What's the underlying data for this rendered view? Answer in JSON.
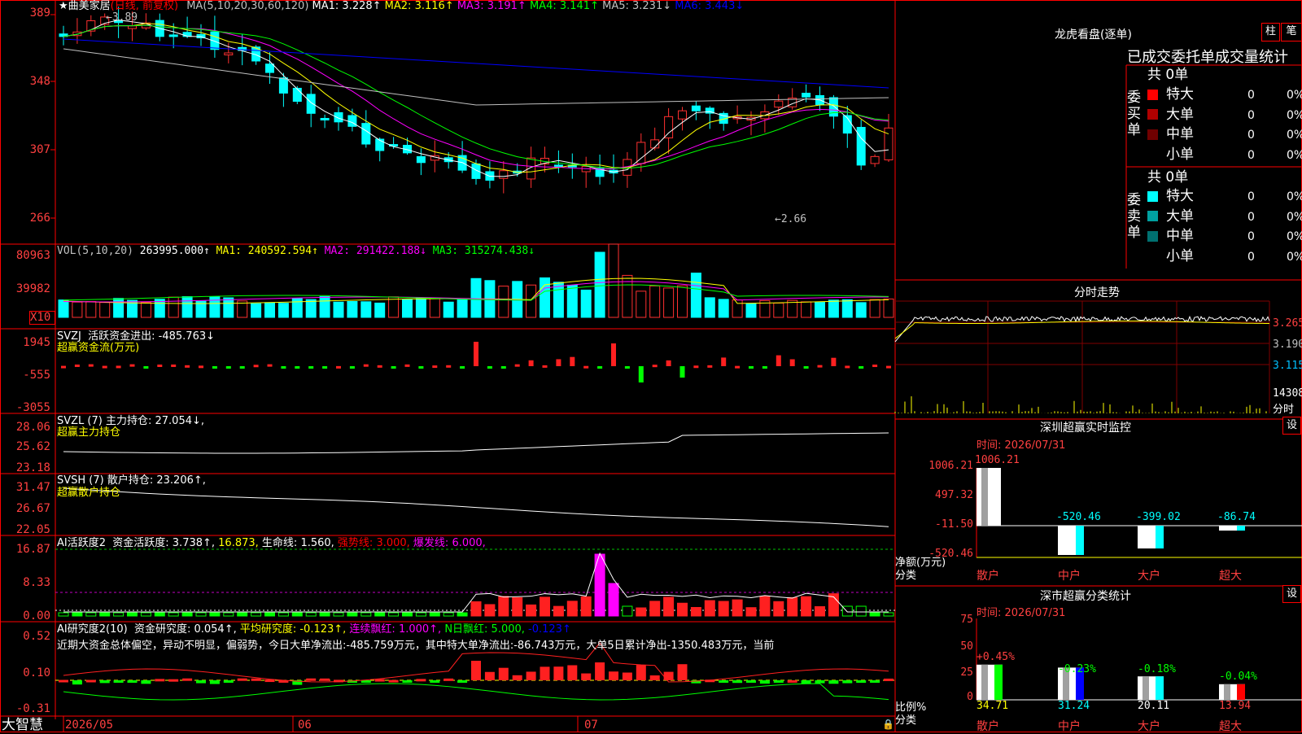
{
  "stock": {
    "name": "★曲美家居",
    "period": "(日线, 前复权)"
  },
  "main": {
    "ma_label": "MA(5,10,20,30,60,120)",
    "ma_items": [
      {
        "text": "MA1: 3.228↑",
        "color": "#ffffff"
      },
      {
        "text": "MA2: 3.116↑",
        "color": "#ffff00"
      },
      {
        "text": "MA3: 3.191↑",
        "color": "#ff00ff"
      },
      {
        "text": "MA4: 3.141↑",
        "color": "#00ff00"
      },
      {
        "text": "MA5: 3.231↓",
        "color": "#c0c0c0"
      },
      {
        "text": "MA6: 3.443↓",
        "color": "#0000ff"
      }
    ],
    "y_ticks": [
      "389",
      "348",
      "307",
      "266"
    ],
    "high_note": "3.89",
    "low_note": "←2.66"
  },
  "vol": {
    "label": "VOL(5,10,20)",
    "value": "263995.000↑",
    "ma": [
      {
        "text": "MA1: 240592.594↑",
        "color": "#ffff00"
      },
      {
        "text": "MA2: 291422.188↓",
        "color": "#ff00ff"
      },
      {
        "text": "MA3: 315274.438↓",
        "color": "#00ff00"
      }
    ],
    "y_ticks": [
      "80963",
      "39982"
    ],
    "unit": "X10"
  },
  "svzj": {
    "label": "SVZJ",
    "title": "活跃资金进出: -485.763↓",
    "subtitle": "超赢资金流(万元)",
    "y_ticks": [
      "1945",
      "-555",
      "-3055"
    ]
  },
  "svzl": {
    "label": "SVZL (7)",
    "title": "主力持仓: 27.054↓,",
    "subtitle": "超赢主力持仓",
    "y_ticks": [
      "28.06",
      "25.62",
      "23.18"
    ]
  },
  "svsh": {
    "label": "SVSH (7)",
    "title": "散户持仓: 23.206↑,",
    "subtitle": "超赢散户持仓",
    "y_ticks": [
      "31.47",
      "26.67",
      "22.05"
    ]
  },
  "ai_act": {
    "label": "AI活跃度2",
    "items": [
      {
        "text": "资金活跃度: 3.738↑,",
        "color": "#ffffff"
      },
      {
        "text": "16.873,",
        "color": "#ffff00"
      },
      {
        "text": "生命线: 1.560,",
        "color": "#ffffff"
      },
      {
        "text": "强势线: 3.000,",
        "color": "#ff0000"
      },
      {
        "text": "爆发线: 6.000,",
        "color": "#ff00ff"
      }
    ],
    "y_ticks": [
      "16.87",
      "8.33",
      "0.00"
    ]
  },
  "ai_res": {
    "label": "AI研究度2(10)",
    "items": [
      {
        "text": "资金研究度: 0.054↑,",
        "color": "#ffffff"
      },
      {
        "text": "平均研究度: -0.123↑,",
        "color": "#ffff00"
      },
      {
        "text": "连续飘红: 1.000↑,",
        "color": "#ff00ff"
      },
      {
        "text": "N日飘红: 5.000,",
        "color": "#00ff00"
      },
      {
        "text": "-0.123↑",
        "color": "#0000ff"
      }
    ],
    "comment": "近期大资金总体偏空，异动不明显，偏弱势，今日大单净流出:-485.759万元，其中特大单净流出:-86.743万元，大单5日累计净出-1350.483万元，当前",
    "y_ticks": [
      "0.52",
      "0.10",
      "-0.31"
    ]
  },
  "x_axis": {
    "brand": "大智慧",
    "labels": [
      "2026/05",
      "06",
      "07"
    ]
  },
  "dragon": {
    "title": "龙虎看盘(逐单)",
    "btn_col": "柱",
    "btn_pen": "笔",
    "subtitle": "已成交委托单成交量统计",
    "buy": {
      "side": "委买单",
      "total": "共 0单",
      "rows": [
        {
          "label": "特大",
          "count": "0",
          "pct": "0%",
          "color": "#ff0000"
        },
        {
          "label": "大单",
          "count": "0",
          "pct": "0%",
          "color": "#b00000"
        },
        {
          "label": "中单",
          "count": "0",
          "pct": "0%",
          "color": "#700000"
        },
        {
          "label": "小单",
          "count": "0",
          "pct": "0%",
          "color": "#000000"
        }
      ]
    },
    "sell": {
      "side": "委卖单",
      "total": "共 0单",
      "rows": [
        {
          "label": "特大",
          "count": "0",
          "pct": "0%",
          "color": "#00ffff"
        },
        {
          "label": "大单",
          "count": "0",
          "pct": "0%",
          "color": "#00a0a0"
        },
        {
          "label": "中单",
          "count": "0",
          "pct": "0%",
          "color": "#007070"
        },
        {
          "label": "小单",
          "count": "0",
          "pct": "0%",
          "color": "#000000"
        }
      ]
    }
  },
  "intraday": {
    "title": "分时走势",
    "prices": [
      "3.265",
      "3.190",
      "3.115"
    ],
    "vol": "14308",
    "vol_unit": "分时"
  },
  "monitor": {
    "title": "深圳超赢实时监控",
    "set": "设",
    "time": "时间: 2026/07/31",
    "y_ticks": [
      "1006.21",
      "497.32",
      "-11.50",
      "-520.46"
    ],
    "ylabel": "净额(万元)",
    "xlabel": "分类",
    "bars": [
      {
        "cat": "散户",
        "value": "1006.21"
      },
      {
        "cat": "中户",
        "value": "-520.46"
      },
      {
        "cat": "大户",
        "value": "-399.02"
      },
      {
        "cat": "超大",
        "value": "-86.74"
      }
    ]
  },
  "classify": {
    "title": "深市超赢分类统计",
    "set": "设",
    "time": "时间: 2026/07/31",
    "y_ticks": [
      "75",
      "50",
      "25",
      "0"
    ],
    "ylabel": "比例%",
    "xlabel": "分类",
    "bars": [
      {
        "cat": "散户",
        "top": "+0.45%",
        "bottom": "34.71",
        "color": "#ffffff"
      },
      {
        "cat": "中户",
        "top": "-0.23%",
        "bottom": "31.24",
        "color": "#0000ff"
      },
      {
        "cat": "大户",
        "top": "-0.18%",
        "bottom": "20.11",
        "color": "#00ffff"
      },
      {
        "cat": "超大",
        "top": "-0.04%",
        "bottom": "13.94",
        "color": "#ff0000"
      }
    ]
  }
}
